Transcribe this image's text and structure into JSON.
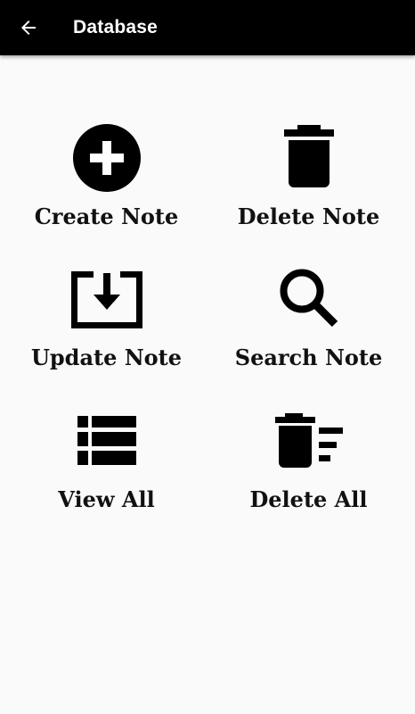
{
  "appbar": {
    "title": "Database",
    "back_icon": "arrow-left-icon",
    "background": "#000000",
    "title_color": "#ffffff"
  },
  "menu": {
    "items": [
      {
        "label": "Create Note",
        "icon": "add-circle-icon"
      },
      {
        "label": "Delete Note",
        "icon": "trash-icon"
      },
      {
        "label": "Update Note",
        "icon": "download-box-icon"
      },
      {
        "label": "Search Note",
        "icon": "search-icon"
      },
      {
        "label": "View All",
        "icon": "list-icon"
      },
      {
        "label": "Delete All",
        "icon": "delete-sweep-icon"
      }
    ]
  },
  "colors": {
    "background": "#fafafa",
    "icon": "#000000",
    "text": "#111111"
  }
}
